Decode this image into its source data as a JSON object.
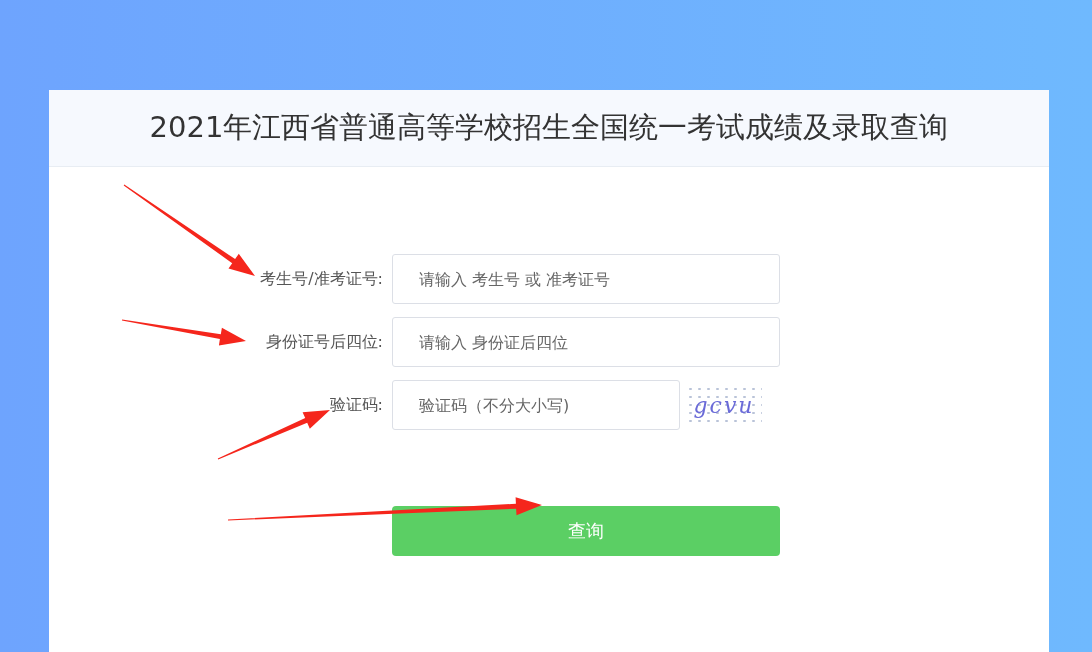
{
  "page_title": "2021年江西省普通高等学校招生全国统一考试成绩及录取查询",
  "fields": [
    {
      "kind": "text",
      "label": "考生号/准考证号:",
      "placeholder": "请输入 考生号 或 准考证号"
    },
    {
      "kind": "text",
      "label": "身份证号后四位:",
      "placeholder": "请输入 身份证后四位"
    },
    {
      "kind": "captcha",
      "label": "验证码:",
      "placeholder": "验证码（不分大小写)",
      "captcha_text": "gcvu"
    }
  ],
  "submit_button": "查询",
  "annotation_arrows": [
    {
      "kind": "arrow"
    },
    {
      "kind": "arrow"
    },
    {
      "kind": "arrow"
    },
    {
      "kind": "arrow"
    }
  ]
}
